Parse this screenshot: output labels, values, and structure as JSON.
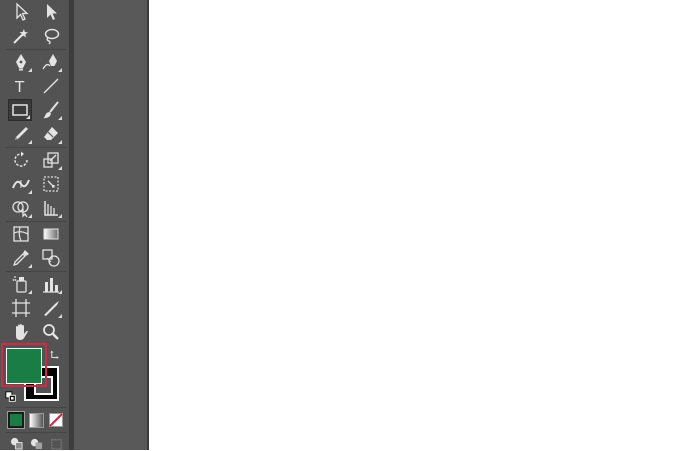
{
  "toolbar": {
    "rows": [
      [
        "selection-tool",
        "direct-selection-tool"
      ],
      [
        "magic-wand-tool",
        "lasso-tool"
      ],
      [
        "pen-tool",
        "curvature-tool"
      ],
      [
        "type-tool",
        "line-segment-tool"
      ],
      [
        "rectangle-tool",
        "paintbrush-tool"
      ],
      [
        "pencil-tool",
        "eraser-tool"
      ],
      [
        "rotate-tool",
        "scale-tool"
      ],
      [
        "width-tool",
        "free-transform-tool"
      ],
      [
        "shape-builder-tool",
        "perspective-grid-tool"
      ],
      [
        "mesh-tool",
        "gradient-tool"
      ],
      [
        "eyedropper-tool",
        "blend-tool"
      ],
      [
        "symbol-sprayer-tool",
        "column-graph-tool"
      ],
      [
        "artboard-tool",
        "slice-tool"
      ],
      [
        "hand-tool",
        "zoom-tool"
      ]
    ],
    "active_tool": "rectangle-tool",
    "type_tool_glyph": "T"
  },
  "colors": {
    "fill": "#1a7d45",
    "stroke": "#ffffff",
    "highlight": "#d42845",
    "panel": "#535353"
  },
  "color_modes": [
    "color",
    "gradient",
    "none"
  ],
  "draw_modes": [
    "draw-normal",
    "draw-behind",
    "draw-inside"
  ]
}
